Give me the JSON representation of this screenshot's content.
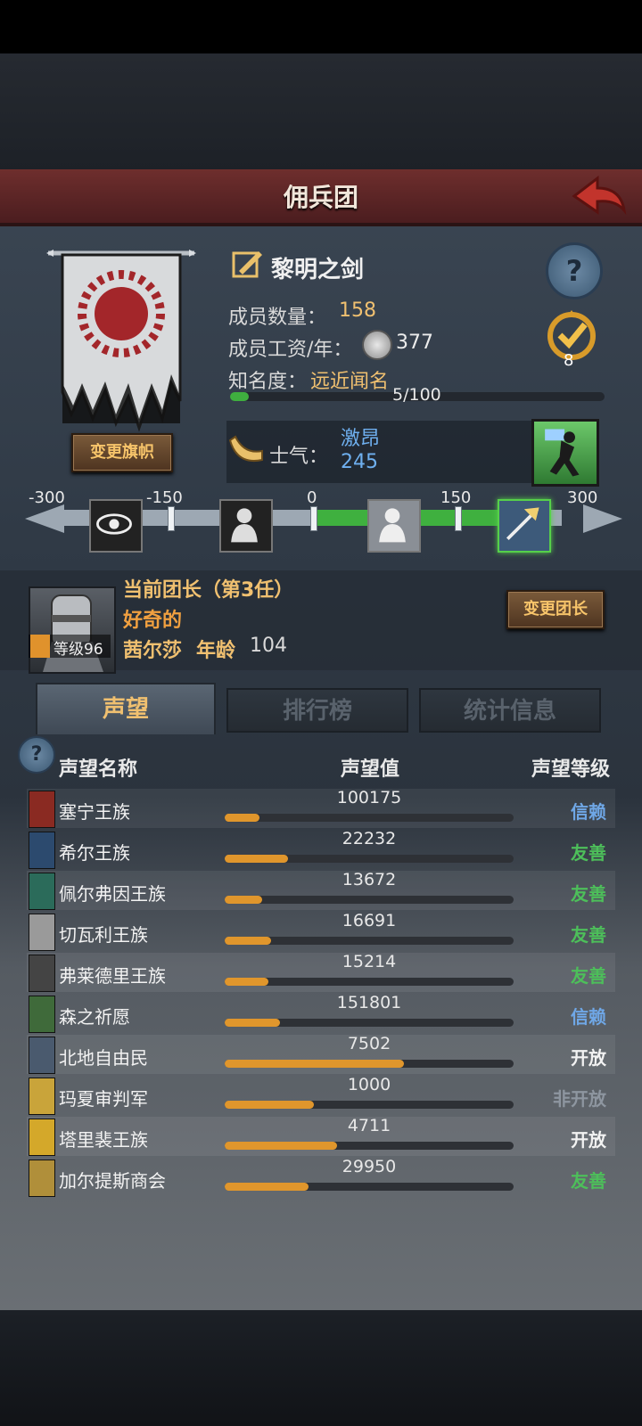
{
  "header": {
    "title": "佣兵团"
  },
  "band": {
    "name": "黎明之剑",
    "members_label": "成员数量：",
    "members": "158",
    "salary_label": "成员工资/年：",
    "salary": "377",
    "fame_label": "知名度：",
    "fame_value": "远近闻名",
    "fame_progress_text": "5/100",
    "fame_progress": 0.05,
    "change_flag_button": "变更旗帜",
    "badge_count": "8"
  },
  "morale": {
    "label": "士气：",
    "state": "激昂",
    "value": "245",
    "scale": [
      "-300",
      "-150",
      "0",
      "150",
      "300"
    ]
  },
  "leader": {
    "title": "当前团长（第3任）",
    "trait": "好奇的",
    "name": "茜尔莎",
    "age_label": "年龄",
    "age": "104",
    "level_label": "等级96",
    "change_button": "变更团长"
  },
  "tabs": [
    {
      "label": "声望",
      "active": true
    },
    {
      "label": "排行榜",
      "active": false
    },
    {
      "label": "统计信息",
      "active": false
    }
  ],
  "table": {
    "headers": {
      "name": "声望名称",
      "value": "声望值",
      "level": "声望等级"
    },
    "rows": [
      {
        "name": "塞宁王族",
        "value": "100175",
        "fill": 0.12,
        "level": "信赖",
        "level_color": "#6fa7e6",
        "icon_color": "#8a2a22"
      },
      {
        "name": "希尔王族",
        "value": "22232",
        "fill": 0.22,
        "level": "友善",
        "level_color": "#4dbf5a",
        "icon_color": "#2c4a6e"
      },
      {
        "name": "佩尔弗因王族",
        "value": "13672",
        "fill": 0.13,
        "level": "友善",
        "level_color": "#4dbf5a",
        "icon_color": "#2b6b5a"
      },
      {
        "name": "切瓦利王族",
        "value": "16691",
        "fill": 0.16,
        "level": "友善",
        "level_color": "#4dbf5a",
        "icon_color": "#9a9a9a"
      },
      {
        "name": "弗莱德里王族",
        "value": "15214",
        "fill": 0.15,
        "level": "友善",
        "level_color": "#4dbf5a",
        "icon_color": "#444444"
      },
      {
        "name": "森之祈愿",
        "value": "151801",
        "fill": 0.19,
        "level": "信赖",
        "level_color": "#6fa7e6",
        "icon_color": "#3f6a3a"
      },
      {
        "name": "北地自由民",
        "value": "7502",
        "fill": 0.62,
        "level": "开放",
        "level_color": "#f2f2f2",
        "icon_color": "#4a5a6e"
      },
      {
        "name": "玛夏审判军",
        "value": "1000",
        "fill": 0.31,
        "level": "非开放",
        "level_color": "#8e96a0",
        "icon_color": "#c9a43a"
      },
      {
        "name": "塔里裴王族",
        "value": "4711",
        "fill": 0.39,
        "level": "开放",
        "level_color": "#f2f2f2",
        "icon_color": "#d4a82a"
      },
      {
        "name": "加尔提斯商会",
        "value": "29950",
        "fill": 0.29,
        "level": "友善",
        "level_color": "#4dbf5a",
        "icon_color": "#b08f3a"
      }
    ]
  }
}
